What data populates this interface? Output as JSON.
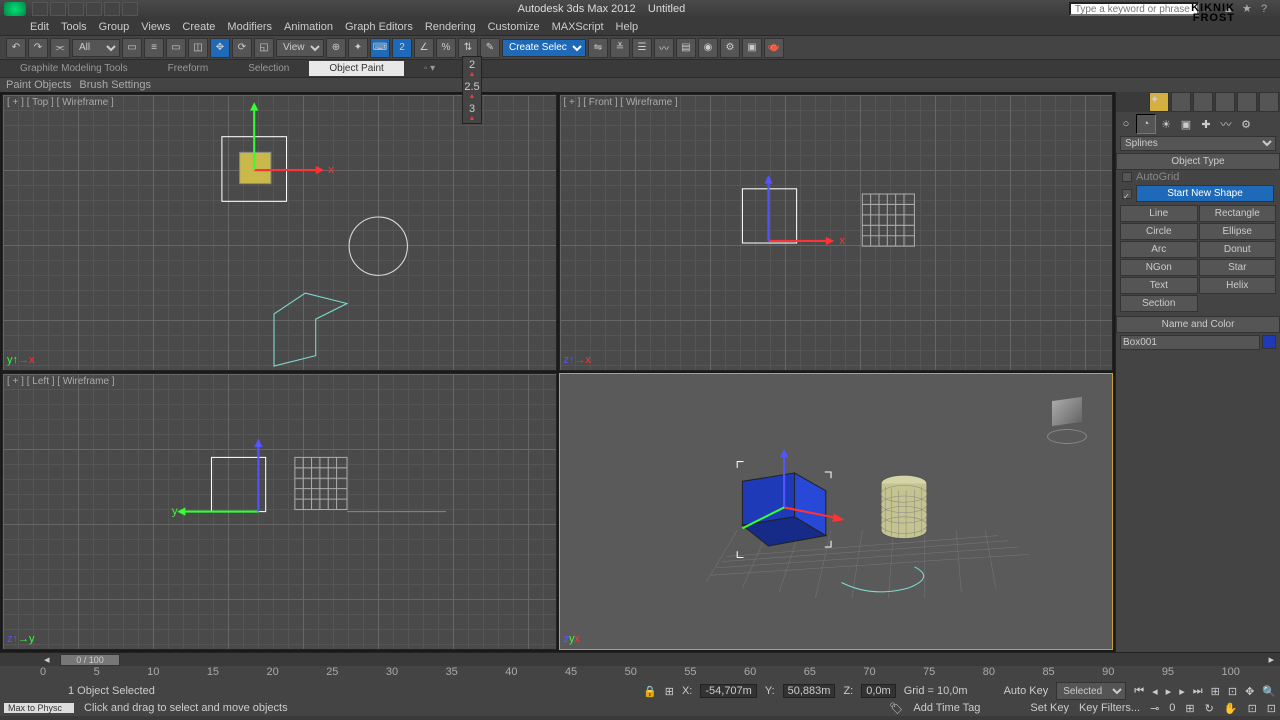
{
  "titlebar": {
    "app": "Autodesk 3ds Max 2012",
    "file": "Untitled",
    "search_placeholder": "Type a keyword or phrase"
  },
  "watermark": {
    "line1": "KIKNIK",
    "line2": "FROST"
  },
  "menu": [
    "Edit",
    "Tools",
    "Group",
    "Views",
    "Create",
    "Modifiers",
    "Animation",
    "Graph Editors",
    "Rendering",
    "Customize",
    "MAXScript",
    "Help"
  ],
  "toolbar": {
    "sel_filter": "All",
    "ref_sys": "View",
    "named_sel": "Create Selection S"
  },
  "ribbon": {
    "tabs": [
      "Graphite Modeling Tools",
      "Freeform",
      "Selection",
      "Object Paint"
    ],
    "sub": [
      "Paint Objects",
      "Brush Settings"
    ]
  },
  "snap_flyout": [
    "2",
    "2.5",
    "3"
  ],
  "viewports": {
    "top": "[ + ] [ Top ] [ Wireframe ]",
    "front": "[ + ] [ Front ] [ Wireframe ]",
    "left": "[ + ] [ Left ] [ Wireframe ]",
    "persp": ""
  },
  "cmdpanel": {
    "category": "Splines",
    "object_type_hdr": "Object Type",
    "autogrid": "AutoGrid",
    "start_new": "Start New Shape",
    "buttons": [
      [
        "Line",
        "Rectangle"
      ],
      [
        "Circle",
        "Ellipse"
      ],
      [
        "Arc",
        "Donut"
      ],
      [
        "NGon",
        "Star"
      ],
      [
        "Text",
        "Helix"
      ],
      [
        "Section",
        ""
      ]
    ],
    "name_color_hdr": "Name and Color",
    "obj_name": "Box001"
  },
  "timeslider": {
    "pos": "0 / 100"
  },
  "ticks": [
    "0",
    "5",
    "10",
    "15",
    "20",
    "25",
    "30",
    "35",
    "40",
    "45",
    "50",
    "55",
    "60",
    "65",
    "70",
    "75",
    "80",
    "85",
    "90",
    "95",
    "100"
  ],
  "status": {
    "selinfo": "1 Object Selected",
    "x": "-54,707m",
    "y": "50,883m",
    "z": "0,0m",
    "grid": "Grid = 10,0m",
    "autokey": "Auto Key",
    "selected": "Selected",
    "setkey": "Set Key",
    "keyfilters": "Key Filters...",
    "addtag": "Add Time Tag",
    "frame": "0"
  },
  "prompt": {
    "maxphys": "Max to Physc",
    "hint": "Click and drag to select and move objects"
  }
}
